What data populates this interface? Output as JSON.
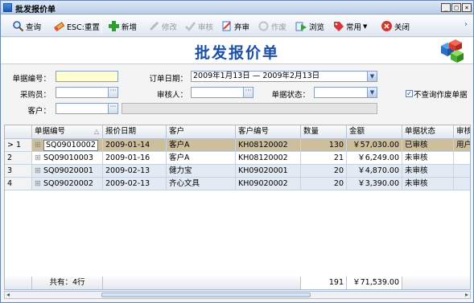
{
  "window": {
    "title": "批发报价单"
  },
  "toolbar": {
    "query": "查询",
    "reset": "ESC:重置",
    "add": "新增",
    "edit": "修改",
    "audit": "审核",
    "unaudit": "弃审",
    "void": "作废",
    "browse": "浏览",
    "common": "常用",
    "close": "关闭"
  },
  "page": {
    "heading": "批发报价单"
  },
  "form": {
    "doc_no_label": "单据编号：",
    "doc_no_value": "",
    "order_date_label": "订单日期：",
    "order_date_value": "2009年1月13日 — 2009年2月13日",
    "buyer_label": "采购员：",
    "buyer_value": "",
    "auditor_label": "审核人：",
    "auditor_value": "",
    "status_label": "单据状态：",
    "status_value": "",
    "exclude_void_label": "不查询作废单据",
    "exclude_void_checked": true,
    "customer_label": "客户：",
    "customer_value": "",
    "customer_name_value": ""
  },
  "grid": {
    "columns": [
      "",
      "单据编号",
      "报价日期",
      "客户",
      "客户编号",
      "数量",
      "金额",
      "单据状态",
      "审核"
    ],
    "rows": [
      {
        "no": "1",
        "marker": ">",
        "doc": "SQ09010002",
        "date": "2009-01-14",
        "customer": "客户A",
        "code": "KH08120002",
        "qty": "130",
        "amount": "￥57,030.00",
        "status": "已审核",
        "audit": "用户"
      },
      {
        "no": "2",
        "marker": "",
        "doc": "SQ09010003",
        "date": "2009-01-16",
        "customer": "客户A",
        "code": "KH08120002",
        "qty": "21",
        "amount": "￥6,249.00",
        "status": "未审核",
        "audit": ""
      },
      {
        "no": "3",
        "marker": "",
        "doc": "SQ09020001",
        "date": "2009-02-13",
        "customer": "健力宝",
        "code": "KH09020001",
        "qty": "20",
        "amount": "￥4,870.00",
        "status": "未审核",
        "audit": ""
      },
      {
        "no": "4",
        "marker": "",
        "doc": "SQ09020002",
        "date": "2009-02-13",
        "customer": "齐心文具",
        "code": "KH09020002",
        "qty": "20",
        "amount": "￥3,390.00",
        "status": "未审核",
        "audit": ""
      }
    ],
    "footer": {
      "count": "共有：4行",
      "qty_total": "191",
      "amount_total": "￥71,539.00"
    }
  },
  "colors": {
    "selected_row": "#cdbf9c",
    "alt_row": "#e2eaf3",
    "heading": "#1c4fa8"
  }
}
